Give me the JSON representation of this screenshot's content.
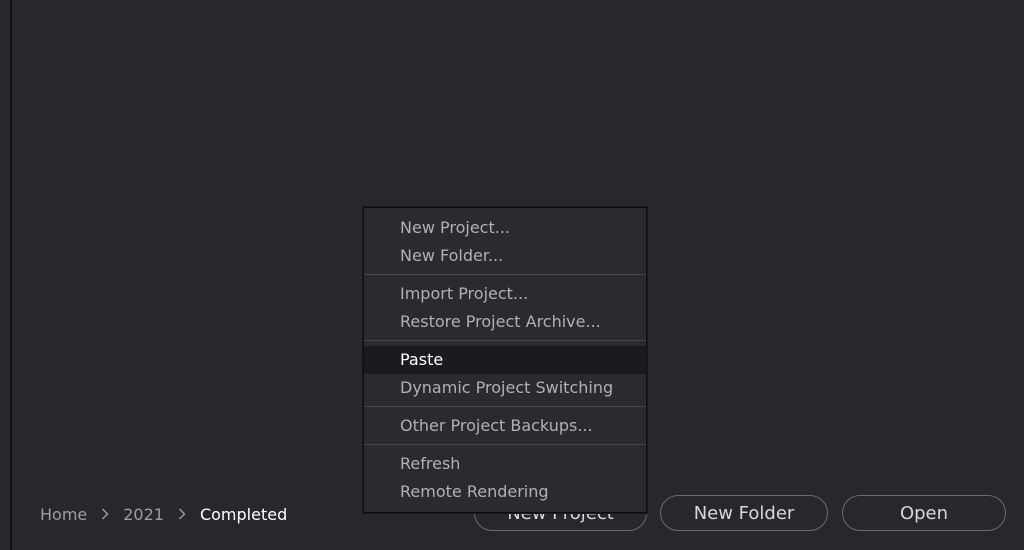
{
  "breadcrumb": {
    "items": [
      "Home",
      "2021",
      "Completed"
    ],
    "separator_icon": "chevron-right-icon"
  },
  "buttons": {
    "new_project": "New Project",
    "new_folder": "New Folder",
    "open": "Open"
  },
  "context_menu": {
    "groups": [
      [
        "New Project...",
        "New Folder..."
      ],
      [
        "Import Project...",
        "Restore Project Archive..."
      ],
      [
        "Paste",
        "Dynamic Project Switching"
      ],
      [
        "Other Project Backups..."
      ],
      [
        "Refresh",
        "Remote Rendering"
      ]
    ],
    "highlighted": "Paste"
  },
  "colors": {
    "background": "#28272c",
    "menu_background": "#2b2a30",
    "menu_highlight": "#1b1a1f",
    "text_muted": "#b0b0b5",
    "text_active": "#ffffff"
  }
}
